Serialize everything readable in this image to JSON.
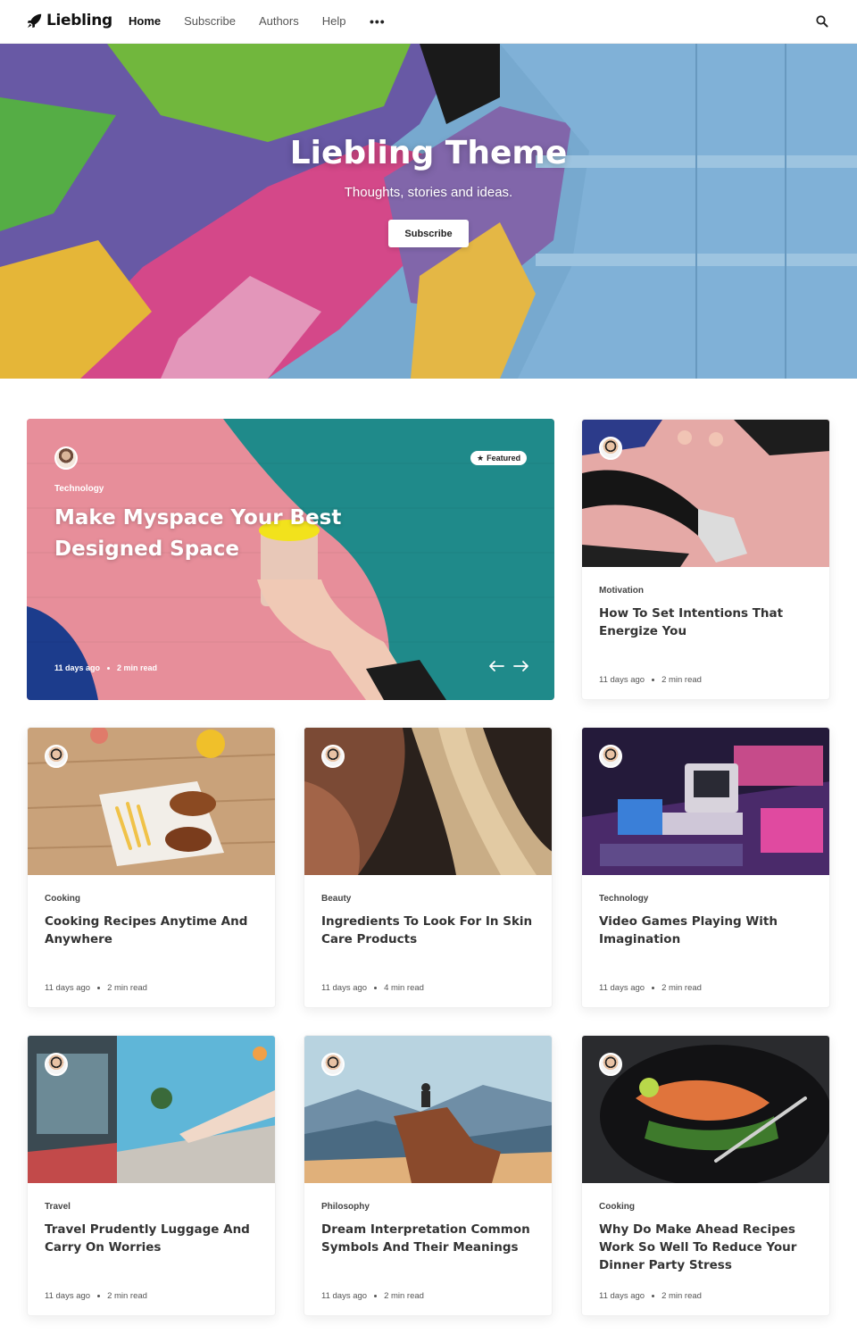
{
  "nav": {
    "brand": "Liebling",
    "links": [
      "Home",
      "Subscribe",
      "Authors",
      "Help"
    ],
    "more": "•••"
  },
  "hero": {
    "title": "Liebling Theme",
    "subtitle": "Thoughts, stories and ideas.",
    "button": "Subscribe"
  },
  "featured": {
    "badge": "Featured",
    "tag": "Technology",
    "title": "Make Myspace Your Best Designed Space",
    "date": "11 days ago",
    "read": "2 min read"
  },
  "cards": [
    {
      "tag": "Motivation",
      "title": "How To Set Intentions That Energize You",
      "date": "11 days ago",
      "read": "2 min read"
    },
    {
      "tag": "Cooking",
      "title": "Cooking Recipes Anytime And Anywhere",
      "date": "11 days ago",
      "read": "2 min read"
    },
    {
      "tag": "Beauty",
      "title": "Ingredients To Look For In Skin Care Products",
      "date": "11 days ago",
      "read": "4 min read"
    },
    {
      "tag": "Technology",
      "title": "Video Games Playing With Imagination",
      "date": "11 days ago",
      "read": "2 min read"
    },
    {
      "tag": "Travel",
      "title": "Travel Prudently Luggage And Carry On Worries",
      "date": "11 days ago",
      "read": "2 min read"
    },
    {
      "tag": "Philosophy",
      "title": "Dream Interpretation Common Symbols And Their Meanings",
      "date": "11 days ago",
      "read": "2 min read"
    },
    {
      "tag": "Cooking",
      "title": "Why Do Make Ahead Recipes Work So Well To Reduce Your Dinner Party Stress",
      "date": "11 days ago",
      "read": "2 min read"
    }
  ]
}
